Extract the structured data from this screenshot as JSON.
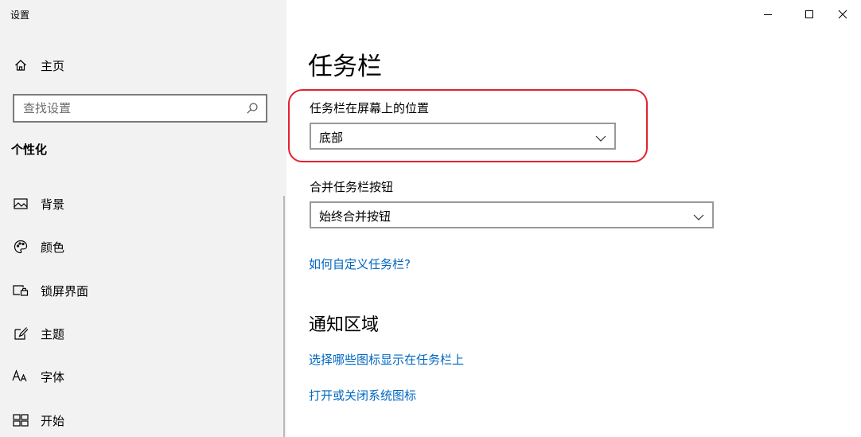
{
  "window": {
    "title": "设置",
    "controls": [
      "minimize",
      "maximize",
      "close"
    ]
  },
  "sidebar": {
    "home_label": "主页",
    "search_placeholder": "查找设置",
    "section_heading": "个性化",
    "items": [
      {
        "label": "背景",
        "icon": "image-icon"
      },
      {
        "label": "颜色",
        "icon": "palette-icon"
      },
      {
        "label": "锁屏界面",
        "icon": "lock-screen-icon"
      },
      {
        "label": "主题",
        "icon": "theme-brush-icon"
      },
      {
        "label": "字体",
        "icon": "font-icon"
      },
      {
        "label": "开始",
        "icon": "start-menu-icon"
      }
    ]
  },
  "main": {
    "title": "任务栏",
    "location": {
      "label": "任务栏在屏幕上的位置",
      "value": "底部"
    },
    "combine": {
      "label": "合并任务栏按钮",
      "value": "始终合并按钮"
    },
    "customize_link": "如何自定义任务栏?",
    "notification_area": {
      "heading": "通知区域",
      "links": [
        "选择哪些图标显示在任务栏上",
        "打开或关闭系统图标"
      ]
    },
    "highlight_color": "#e3212e",
    "link_color": "#0067c0"
  }
}
